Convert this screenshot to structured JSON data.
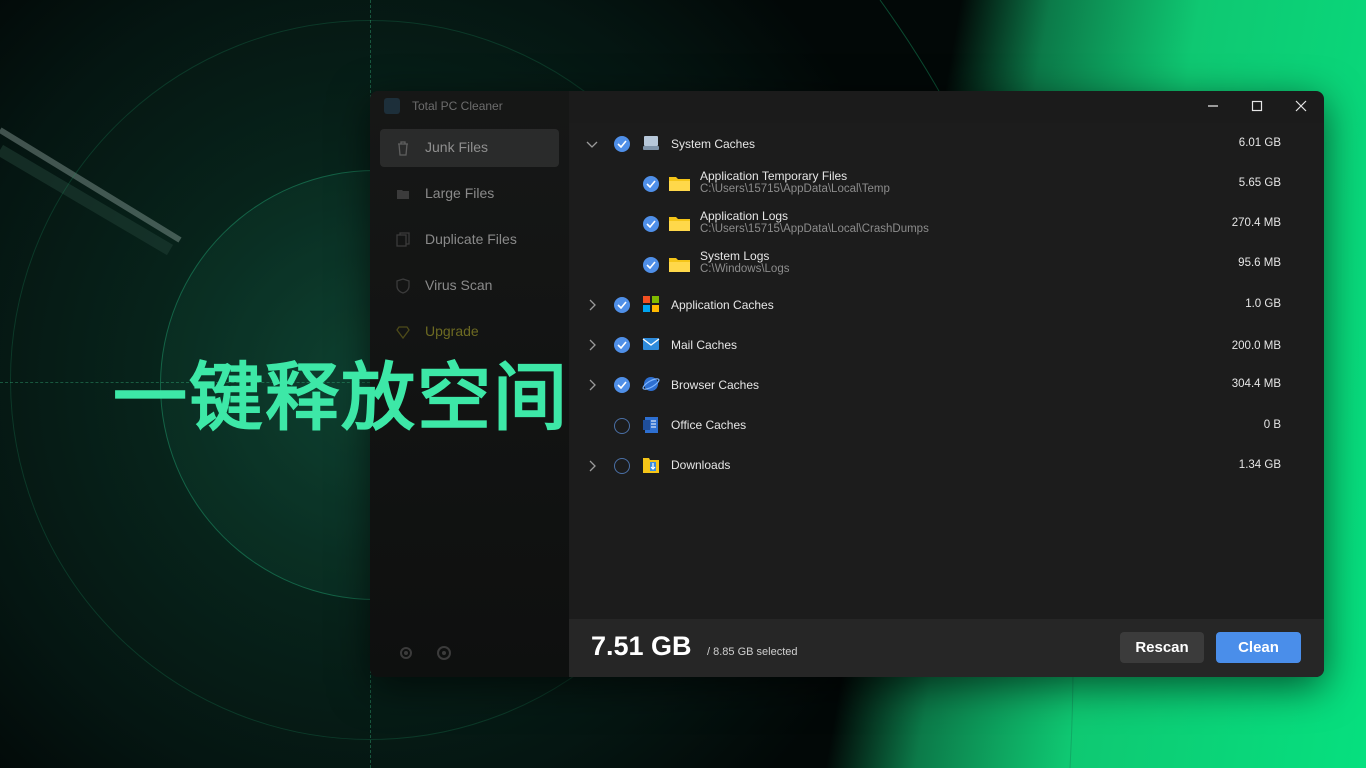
{
  "slogan": "一键释放空间",
  "window": {
    "title": "Total PC Cleaner",
    "controls": {
      "minimize": "—",
      "maximize": "☐",
      "close": "✕"
    }
  },
  "sidebar": {
    "items": [
      {
        "label": "Junk Files",
        "icon": "trash-icon",
        "active": true
      },
      {
        "label": "Large Files",
        "icon": "folder-icon",
        "active": false
      },
      {
        "label": "Duplicate Files",
        "icon": "duplicate-icon",
        "active": false
      },
      {
        "label": "Virus Scan",
        "icon": "shield-icon",
        "active": false
      },
      {
        "label": "Upgrade",
        "icon": "diamond-icon",
        "active": false
      }
    ],
    "bottom_icons": [
      "gear-icon",
      "feedback-icon"
    ]
  },
  "list": [
    {
      "label": "System Caches",
      "size": "6.01 GB",
      "checked": true,
      "expanded": true,
      "icon": "drive-icon",
      "children": [
        {
          "label": "Application Temporary Files",
          "path": "C:\\Users\\15715\\AppData\\Local\\Temp",
          "size": "5.65 GB",
          "checked": true,
          "icon": "folder-icon"
        },
        {
          "label": "Application Logs",
          "path": "C:\\Users\\15715\\AppData\\Local\\CrashDumps",
          "size": "270.4 MB",
          "checked": true,
          "icon": "folder-icon"
        },
        {
          "label": "System Logs",
          "path": "C:\\Windows\\Logs",
          "size": "95.6 MB",
          "checked": true,
          "icon": "folder-icon"
        }
      ]
    },
    {
      "label": "Application Caches",
      "size": "1.0 GB",
      "checked": true,
      "expanded": false,
      "icon": "windows-logo-icon"
    },
    {
      "label": "Mail Caches",
      "size": "200.0 MB",
      "checked": true,
      "expanded": false,
      "icon": "mail-icon"
    },
    {
      "label": "Browser Caches",
      "size": "304.4 MB",
      "checked": true,
      "expanded": false,
      "icon": "globe-icon"
    },
    {
      "label": "Office Caches",
      "size": "0 B",
      "checked": false,
      "expanded": null,
      "icon": "office-doc-icon"
    },
    {
      "label": "Downloads",
      "size": "1.34 GB",
      "checked": false,
      "expanded": false,
      "icon": "downloads-folder-icon"
    }
  ],
  "footer": {
    "total": "7.51 GB",
    "selected": "/ 8.85 GB selected",
    "rescan_label": "Rescan",
    "clean_label": "Clean"
  },
  "colors": {
    "accent_blue": "#4a8eea",
    "slogan_green": "#3de8a7",
    "bg_green": "#06e07f"
  }
}
